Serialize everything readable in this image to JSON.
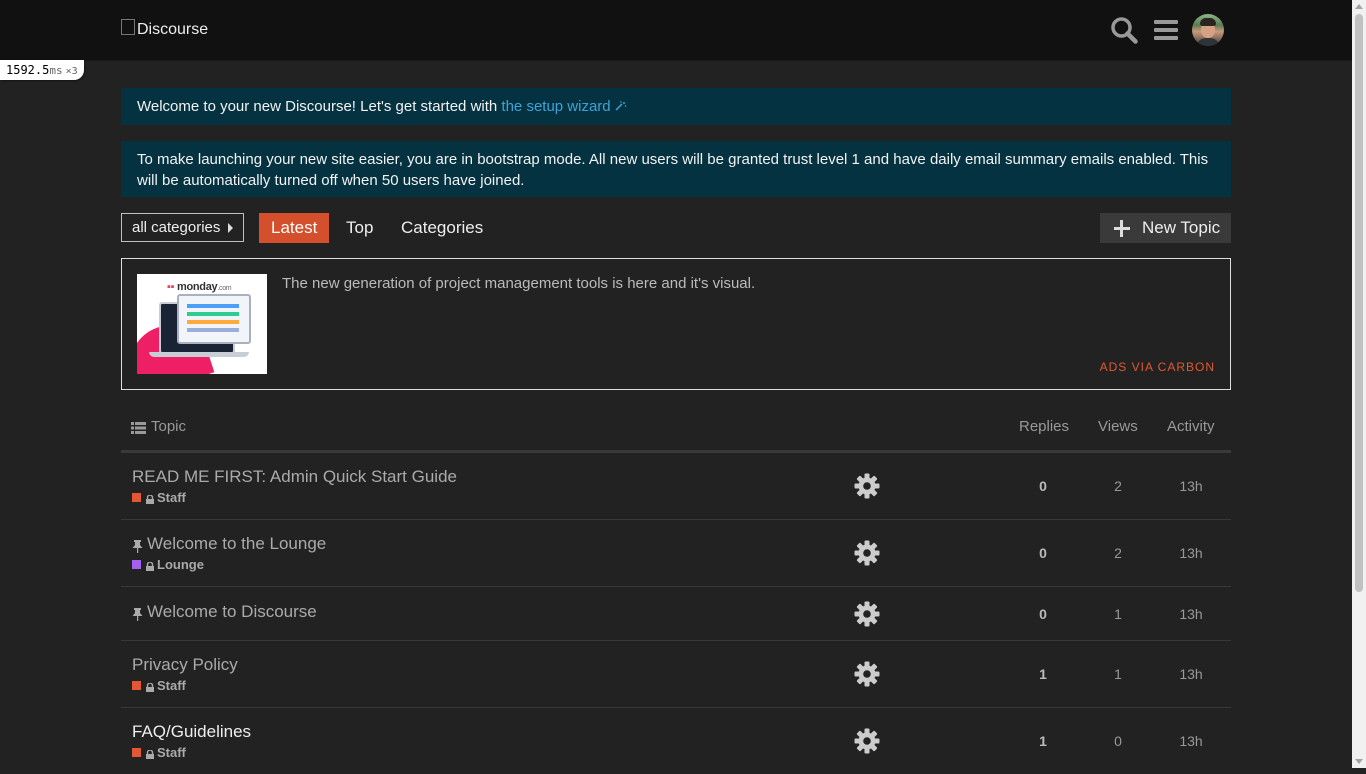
{
  "header": {
    "logo_alt": "Discourse",
    "icons": [
      "search-icon",
      "hamburger-menu-icon",
      "user-avatar"
    ]
  },
  "timer": {
    "value": "1592.5",
    "unit": "ms",
    "multiplier": "×3"
  },
  "notices": {
    "wizard_prefix": "Welcome to your new Discourse! Let's get started with ",
    "wizard_link": "the setup wizard",
    "wizard_icon": "magic-wand-icon",
    "bootstrap": "To make launching your new site easier, you are in bootstrap mode. All new users will be granted trust level 1 and have daily email summary emails enabled. This will be automatically turned off when 50 users have joined."
  },
  "nav": {
    "category_dropdown": "all categories",
    "tabs": [
      {
        "label": "Latest",
        "active": true
      },
      {
        "label": "Top",
        "active": false
      },
      {
        "label": "Categories",
        "active": false
      }
    ],
    "new_topic": "New Topic"
  },
  "ad": {
    "brand": "monday",
    "brand_suffix": ".com",
    "text": "The new generation of project management tools is here and it's visual.",
    "via": "ADS VIA CARBON"
  },
  "topic_list": {
    "headers": {
      "topic": "Topic",
      "replies": "Replies",
      "views": "Views",
      "activity": "Activity"
    },
    "rows": [
      {
        "title": "READ ME FIRST: Admin Quick Start Guide",
        "pinned": false,
        "unread": false,
        "category": "Staff",
        "category_color": "#e45735",
        "replies": "0",
        "views": "2",
        "activity": "13h"
      },
      {
        "title": "Welcome to the Lounge",
        "pinned": true,
        "unread": false,
        "category": "Lounge",
        "category_color": "#a461ef",
        "replies": "0",
        "views": "2",
        "activity": "13h"
      },
      {
        "title": "Welcome to Discourse",
        "pinned": true,
        "unread": false,
        "category": "",
        "category_color": "",
        "replies": "0",
        "views": "1",
        "activity": "13h"
      },
      {
        "title": "Privacy Policy",
        "pinned": false,
        "unread": false,
        "category": "Staff",
        "category_color": "#e45735",
        "replies": "1",
        "views": "1",
        "activity": "13h"
      },
      {
        "title": "FAQ/Guidelines",
        "pinned": false,
        "unread": true,
        "category": "Staff",
        "category_color": "#e45735",
        "replies": "1",
        "views": "0",
        "activity": "13h"
      }
    ]
  },
  "colors": {
    "background": "#222222",
    "header": "#111111",
    "accent": "#d44f2b",
    "notice_bg": "#043240",
    "link": "#3ea3d8"
  }
}
